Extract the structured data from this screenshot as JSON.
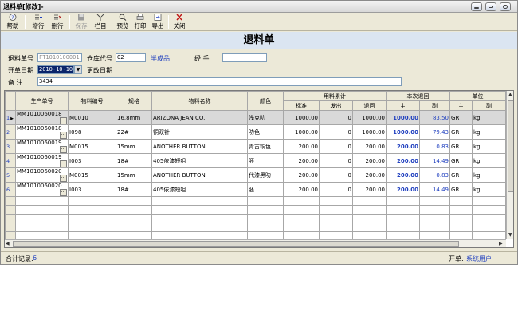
{
  "window": {
    "title": "退料单[修改]-"
  },
  "toolbar": {
    "help": "帮助",
    "add_row": "增行",
    "delete_row": "删行",
    "save": "保存",
    "columns": "栏目",
    "preview": "预览",
    "print": "打印",
    "export": "导出",
    "close": "关闭"
  },
  "doc_title": "退料单",
  "form": {
    "return_no_label": "退料单号",
    "return_no": "FT1010100001",
    "warehouse_label": "仓库代号",
    "warehouse_code": "02",
    "warehouse_name": "半成品",
    "handler_label": "经    手",
    "handler": "",
    "date_label": "开单日期",
    "date": "2010-10-10",
    "change_date_label": "更改日期",
    "remark_label": "备    注",
    "remark": "3434"
  },
  "grid": {
    "group_headers": {
      "usage": "用料累计",
      "this_return": "本次退回",
      "unit": "单位"
    },
    "headers": {
      "prod_no": "生产单号",
      "material_no": "物料编号",
      "spec": "规格",
      "material_name": "物料名称",
      "color": "颜色",
      "standard": "标准",
      "issued": "发出",
      "returned": "退回",
      "main": "主",
      "sub": "副",
      "unit_main": "主",
      "unit_sub": "副"
    },
    "rows": [
      {
        "n": "1",
        "prod": "MM1010060018",
        "mat": "M0010",
        "spec": "16.8mm",
        "name": "ARIZONA JEAN CO.",
        "color": "浅克叻",
        "std": "1000.00",
        "iss": "0",
        "ret": "1000.00",
        "main": "1000.00",
        "sub": "83.50",
        "u1": "GR",
        "u2": "kg"
      },
      {
        "n": "2",
        "prod": "MM1010060018",
        "mat": "I098",
        "spec": "22#",
        "name": "铜双针",
        "color": "叻色",
        "std": "1000.00",
        "iss": "0",
        "ret": "1000.00",
        "main": "1000.00",
        "sub": "79.43",
        "u1": "GR",
        "u2": "kg"
      },
      {
        "n": "3",
        "prod": "MM1010060019",
        "mat": "M0015",
        "spec": "15mm",
        "name": "ANOTHER BUTTON",
        "color": "青古铜色",
        "std": "200.00",
        "iss": "0",
        "ret": "200.00",
        "main": "200.00",
        "sub": "0.83",
        "u1": "GR",
        "u2": "kg"
      },
      {
        "n": "4",
        "prod": "MM1010060019",
        "mat": "I003",
        "spec": "18#",
        "name": "405依漆短咀",
        "color": "胚",
        "std": "200.00",
        "iss": "0",
        "ret": "200.00",
        "main": "200.00",
        "sub": "14.49",
        "u1": "GR",
        "u2": "kg"
      },
      {
        "n": "5",
        "prod": "MM1010060020",
        "mat": "M0015",
        "spec": "15mm",
        "name": "ANOTHER BUTTON",
        "color": "代漆黑叻",
        "std": "200.00",
        "iss": "0",
        "ret": "200.00",
        "main": "200.00",
        "sub": "0.83",
        "u1": "GR",
        "u2": "kg"
      },
      {
        "n": "6",
        "prod": "MM1010060020",
        "mat": "I003",
        "spec": "18#",
        "name": "405依漆短咀",
        "color": "胚",
        "std": "200.00",
        "iss": "0",
        "ret": "200.00",
        "main": "200.00",
        "sub": "14.49",
        "u1": "GR",
        "u2": "kg"
      }
    ],
    "ellipsis": "···"
  },
  "status": {
    "total_label": "合计记录:",
    "total": "6",
    "opener_label": "开单:",
    "opener": "系统用户"
  },
  "colors": {
    "accent_blue": "#1f3fbf",
    "header_band": "#dbe5f1",
    "chrome": "#ece9d8"
  }
}
